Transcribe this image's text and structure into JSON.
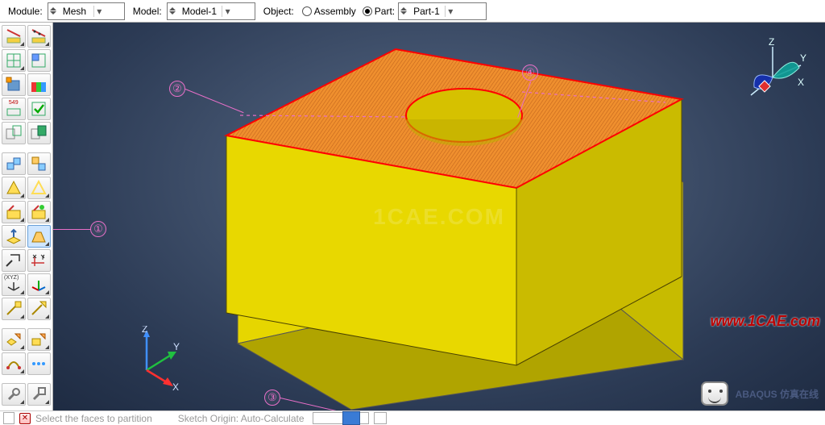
{
  "context_bar": {
    "module_label": "Module:",
    "module_value": "Mesh",
    "model_label": "Model:",
    "model_value": "Model-1",
    "object_label": "Object:",
    "radio_assembly": "Assembly",
    "radio_part": "Part:",
    "part_value": "Part-1",
    "selected_radio": "part"
  },
  "toolbox": {
    "buttons": [
      [
        "seed-part-icon",
        "seed-edges-icon"
      ],
      [
        "mesh-part-icon",
        "mesh-region-icon"
      ],
      [
        "element-type-icon",
        "mesh-controls-colored-icon"
      ],
      [
        "mesh-549-icon",
        "verify-mesh-green-icon"
      ],
      [
        "mesh-group-a-icon",
        "mesh-group-b-icon"
      ],
      [
        "sep"
      ],
      [
        "partition-cell-icon",
        "partition-face-icon"
      ],
      [
        "partition-edge-a-icon",
        "partition-edge-b-icon"
      ],
      [
        "assign-mesh-a-icon",
        "assign-mesh-b-icon"
      ],
      [
        "assign-stack-icon",
        "virtual-topology-icon"
      ],
      [
        "query-icon",
        "xy-icon"
      ],
      [
        "coord-sys-axes-icon",
        "coord-sys-b-icon"
      ],
      [
        "datum-a-icon",
        "datum-b-icon"
      ],
      [
        "sep"
      ],
      [
        "swept-a-icon",
        "swept-b-icon"
      ],
      [
        "curve-icon",
        "dotted-blue-icon"
      ],
      [
        "sep"
      ],
      [
        "tool-a-icon",
        "tool-b-icon"
      ]
    ],
    "button_549_text": "549"
  },
  "annotations": {
    "a1": "①",
    "a2": "②",
    "a3": "③",
    "a4": "④"
  },
  "viewport": {
    "axis_x": "X",
    "axis_y": "Y",
    "axis_z": "Z",
    "watermark_center": "1CAE.COM",
    "watermark_url": "www.1CAE.com",
    "watermark_brand": "ABAQUS 仿真在线"
  },
  "prompt_bar": {
    "hint_fragment_left": "Select the faces to partition",
    "hint_fragment_right": "Sketch Origin: Auto-Calculate"
  },
  "colors": {
    "annotation": "#e86fc8",
    "top_face_fill": "#e88a2a",
    "top_face_edge": "#ff0000",
    "side_face_fill": "#e6d600",
    "viewport_bg_center": "#5a6c88",
    "viewport_bg_edge": "#1e2b42"
  }
}
